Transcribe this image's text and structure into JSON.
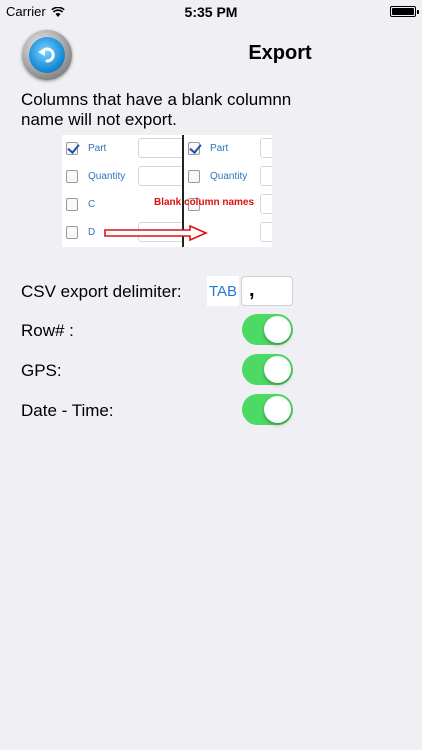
{
  "status_bar": {
    "carrier": "Carrier",
    "time": "5:35 PM"
  },
  "header": {
    "title": "Export",
    "back_icon": "back-arrow-icon"
  },
  "note": "Columns that have a blank columnn name will not export.",
  "example_image": {
    "left_column": [
      {
        "label": "Part",
        "checked": true
      },
      {
        "label": "Quantity",
        "checked": false
      },
      {
        "label": "C",
        "checked": false
      },
      {
        "label": "D",
        "checked": false
      }
    ],
    "right_column": [
      {
        "label": "Part",
        "checked": true
      },
      {
        "label": "Quantity",
        "checked": false
      }
    ],
    "annotation": "Blank column names",
    "annotation_color": "#e01010"
  },
  "settings": {
    "delimiter": {
      "label": "CSV export delimiter:",
      "tab_label": "TAB",
      "value": ","
    },
    "row_number": {
      "label": "Row# :",
      "on": true
    },
    "gps": {
      "label": "GPS:",
      "on": true
    },
    "date_time": {
      "label": "Date - Time:",
      "on": true
    }
  },
  "colors": {
    "toggle_on": "#4cd964",
    "accent": "#1f7ad1",
    "background": "#efeff4"
  }
}
